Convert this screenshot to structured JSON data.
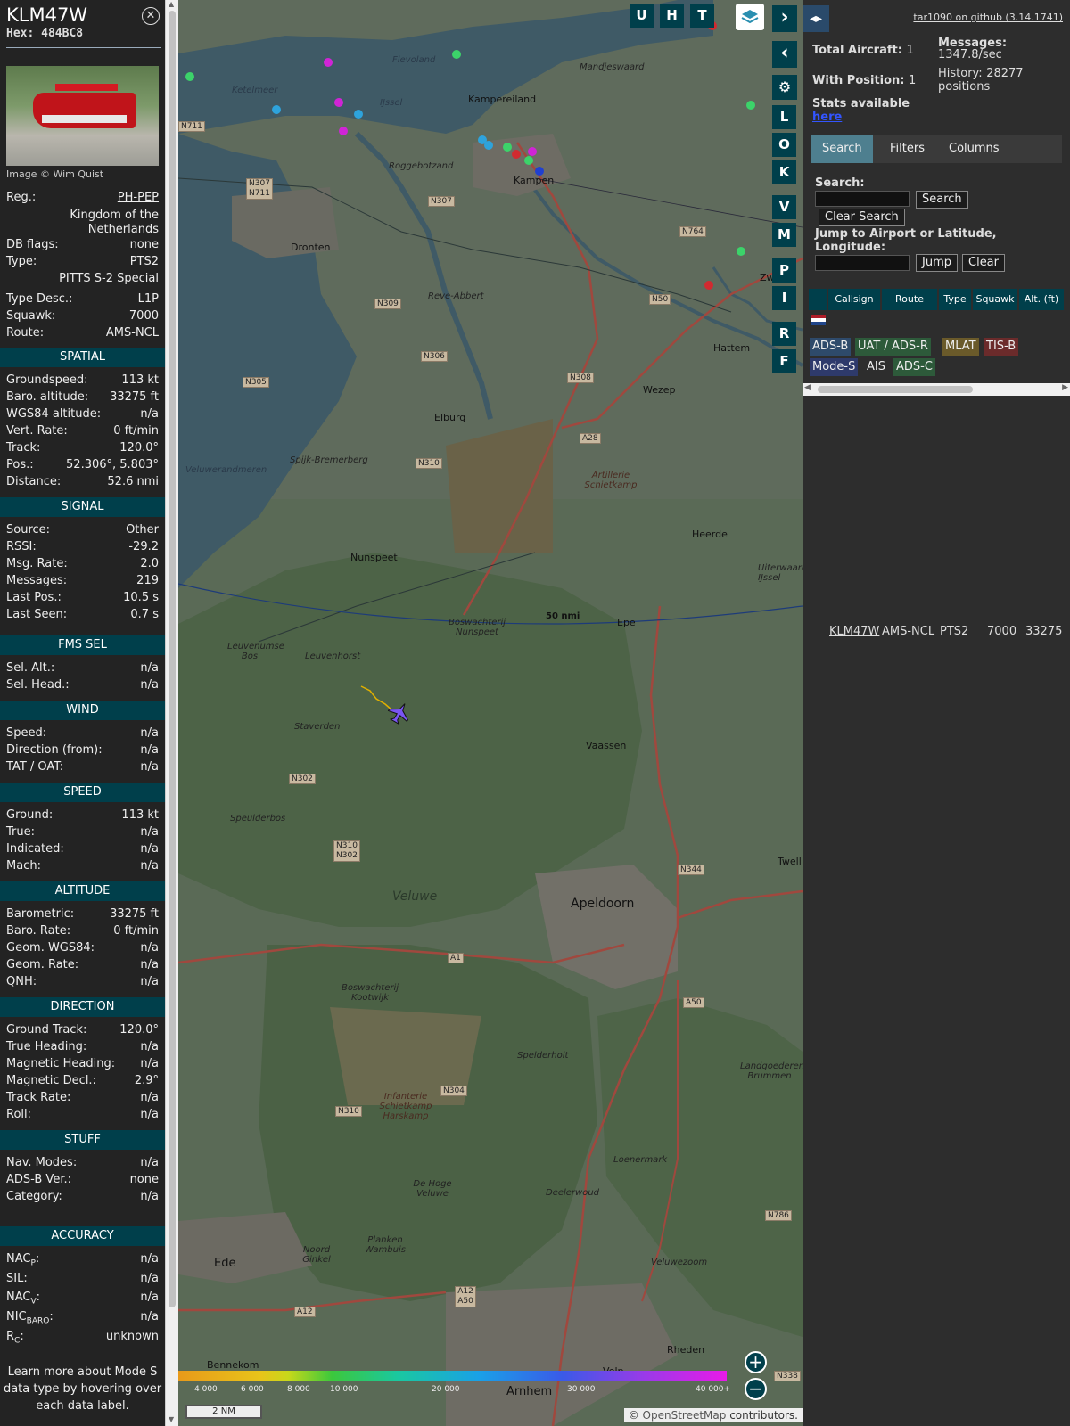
{
  "panel": {
    "callsign": "KLM47W",
    "hex_line": "Hex: 484BC8",
    "photo_credit": "Image © Wim Quist",
    "reg_label": "Reg.:",
    "reg": "PH-PEP",
    "country": "Kingdom of the Netherlands",
    "db_flags_label": "DB flags:",
    "db_flags": "none",
    "type_label": "Type:",
    "type": "PTS2",
    "type_full": "PITTS S-2 Special",
    "type_desc_label": "Type Desc.:",
    "type_desc": "L1P",
    "squawk_label": "Squawk:",
    "squawk": "7000",
    "route_label": "Route:",
    "route": "AMS-NCL",
    "sections": {
      "spatial": "SPATIAL",
      "signal": "SIGNAL",
      "fms": "FMS SEL",
      "wind": "WIND",
      "speed": "SPEED",
      "altitude": "ALTITUDE",
      "direction": "DIRECTION",
      "stuff": "STUFF",
      "accuracy": "ACCURACY"
    },
    "spatial": [
      {
        "k": "Groundspeed:",
        "v": "113 kt"
      },
      {
        "k": "Baro. altitude:",
        "v": "33275 ft"
      },
      {
        "k": "WGS84 altitude:",
        "v": "n/a"
      },
      {
        "k": "Vert. Rate:",
        "v": "0 ft/min"
      },
      {
        "k": "Track:",
        "v": "120.0°"
      },
      {
        "k": "Pos.:",
        "v": "52.306°, 5.803°"
      },
      {
        "k": "Distance:",
        "v": "52.6 nmi"
      }
    ],
    "signal": [
      {
        "k": "Source:",
        "v": "Other"
      },
      {
        "k": "RSSI:",
        "v": "-29.2"
      },
      {
        "k": "Msg. Rate:",
        "v": "2.0"
      },
      {
        "k": "Messages:",
        "v": "219"
      },
      {
        "k": "Last Pos.:",
        "v": "10.5 s"
      },
      {
        "k": "Last Seen:",
        "v": "0.7 s"
      }
    ],
    "fms": [
      {
        "k": "Sel. Alt.:",
        "v": "n/a"
      },
      {
        "k": "Sel. Head.:",
        "v": "n/a"
      }
    ],
    "wind": [
      {
        "k": "Speed:",
        "v": "n/a"
      },
      {
        "k": "Direction (from):",
        "v": "n/a"
      },
      {
        "k": "TAT / OAT:",
        "v": "n/a"
      }
    ],
    "speed": [
      {
        "k": "Ground:",
        "v": "113 kt"
      },
      {
        "k": "True:",
        "v": "n/a"
      },
      {
        "k": "Indicated:",
        "v": "n/a"
      },
      {
        "k": "Mach:",
        "v": "n/a"
      }
    ],
    "altitude": [
      {
        "k": "Barometric:",
        "v": "33275 ft"
      },
      {
        "k": "Baro. Rate:",
        "v": "0 ft/min"
      },
      {
        "k": "Geom. WGS84:",
        "v": "n/a"
      },
      {
        "k": "Geom. Rate:",
        "v": "n/a"
      },
      {
        "k": "QNH:",
        "v": "n/a"
      }
    ],
    "direction": [
      {
        "k": "Ground Track:",
        "v": "120.0°"
      },
      {
        "k": "True Heading:",
        "v": "n/a"
      },
      {
        "k": "Magnetic Heading:",
        "v": "n/a"
      },
      {
        "k": "Magnetic Decl.:",
        "v": "2.9°"
      },
      {
        "k": "Track Rate:",
        "v": "n/a"
      },
      {
        "k": "Roll:",
        "v": "n/a"
      }
    ],
    "stuff": [
      {
        "k": "Nav. Modes:",
        "v": "n/a"
      },
      {
        "k": "ADS-B Ver.:",
        "v": "none"
      },
      {
        "k": "Category:",
        "v": "n/a"
      }
    ],
    "accuracy": {
      "nacp_k": "NAC",
      "nacp_sub": "P",
      "nacp_v": "n/a",
      "sil_k": "SIL:",
      "sil_v": "n/a",
      "nacv_k": "NAC",
      "nacv_sub": "V",
      "nacv_v": "n/a",
      "nicbaro_k": "NIC",
      "nicbaro_sub": "BARO",
      "nicbaro_v": "n/a",
      "rc_k": "R",
      "rc_sub": "C",
      "rc_v": "unknown"
    },
    "learn_more": "Learn more about Mode S data type by hovering over each data label."
  },
  "map": {
    "layers_icon": "layers-icon",
    "top_buttons": [
      "U",
      "H",
      "T"
    ],
    "side_buttons": [
      "L",
      "O",
      "K",
      "V",
      "M",
      "P",
      "I",
      "R",
      "F"
    ],
    "range_ring_label": "50 nmi",
    "scale_label": "2 NM",
    "attribution_prefix": "© ",
    "attribution_link": "OpenStreetMap",
    "attribution_suffix": " contributors.",
    "altitude_legend": [
      "4 000",
      "6 000",
      "8 000",
      "10 000",
      "20 000",
      "30 000",
      "40 000+"
    ],
    "places": {
      "kampereiland": "Kampereiland",
      "kampen": "Kampen",
      "dronten": "Dronten",
      "elburg": "Elburg",
      "wezep": "Wezep",
      "hattem": "Hattem",
      "nunspeet": "Nunspeet",
      "epe": "Epe",
      "heerde": "Heerde",
      "vaassen": "Vaassen",
      "apeldoorn": "Apeldoorn",
      "veluwe": "Veluwe",
      "ede": "Ede",
      "bennekom": "Bennekom",
      "arnhem": "Arnhem",
      "rheden": "Rheden",
      "velp": "Velp",
      "ketelmeer": "Ketelmeer",
      "mandjeswaard": "Mandjeswaard",
      "artillerie": "Artillerie Schietkamp",
      "infanterie": "Infanterie Schietkamp Harskamp",
      "boswachterij_k": "Boswachterij Kootwijk",
      "de_hoge_veluwe": "De Hoge Veluwe",
      "veluwezoom": "Veluwezoom",
      "leuvenhorst": "Leuvenhorst",
      "staverden": "Staverden",
      "veluwerandmeren": "Veluwerandmeren",
      "reve_abbert": "Reve-Abbert",
      "roggebotzand": "Roggebotzand",
      "spijk": "Spijk-Bremerberg",
      "flevoland": "Flevoland",
      "speulderbos": "Speulderbos",
      "deelerwoud": "Deelerwoud",
      "loenermark": "Loenermark",
      "planken": "Planken Wambuis",
      "noord_ginkel": "Noord Ginkel",
      "spelderholt": "Spelderholt",
      "landgoederen": "Landgoederen Brummen",
      "leuvenumse": "Leuvenumse Bos",
      "boswachterij_n": "Boswachterij Nunspeet",
      "ijssel": "IJssel",
      "zwolle": "Zw",
      "twello": "Twell",
      "uiterwaarden": "Uiterwaarden IJssel"
    },
    "roads": [
      "N711",
      "N307 N711",
      "N307",
      "N309",
      "N306",
      "N305",
      "N310",
      "N308",
      "N50",
      "N764",
      "A28",
      "N302",
      "N310 N302",
      "N344",
      "A1",
      "A50",
      "N304",
      "N310",
      "N786",
      "A12 A50",
      "A12",
      "N338"
    ]
  },
  "right": {
    "github_link": "tar1090 on github (3.14.1741)",
    "total_aircraft_label": "Total Aircraft:",
    "total_aircraft": "1",
    "with_position_label": "With Position:",
    "with_position": "1",
    "messages_label": "Messages:",
    "messages_rate": "1347.8/sec",
    "history_label": "History:",
    "history_value": "28277 positions",
    "stats_label": "Stats available",
    "stats_link": "here",
    "tabs": [
      "Search",
      "Filters",
      "Columns"
    ],
    "search_label": "Search:",
    "search_button": "Search",
    "clear_search_button": "Clear Search",
    "jump_label": "Jump to Airport or Latitude, Longitude:",
    "jump_button": "Jump",
    "clear_button": "Clear",
    "table_headers": [
      "Callsign",
      "Route",
      "Type",
      "Squawk",
      "Alt. (ft)"
    ],
    "table_row": {
      "callsign": "KLM47W",
      "route": "AMS-NCL",
      "type": "PTS2",
      "squawk": "7000",
      "alt": "33275"
    },
    "source_chips": [
      "ADS-B",
      "UAT / ADS-R",
      "MLAT",
      "TIS-B",
      "Mode-S",
      "AIS",
      "ADS-C"
    ]
  },
  "colors": {
    "header_bg": "#003f4b",
    "adsb": "#2e4a6b",
    "uat": "#2d5a3a",
    "mlat": "#6a5a2a",
    "tisb": "#6b2b2b",
    "modes": "#2e3a6b",
    "adsc": "#2d5a3a"
  }
}
